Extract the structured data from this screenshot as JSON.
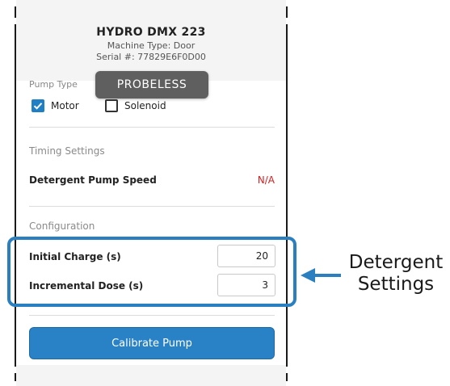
{
  "machine": {
    "name": "HYDRO DMX 223",
    "type_label": "Machine Type: Door",
    "serial_label": "Serial #: 77829E6F0D00"
  },
  "toast": {
    "text": "PROBELESS"
  },
  "section_hint": "Pump Type",
  "pump_type": {
    "options": [
      {
        "label": "Motor",
        "checked": true
      },
      {
        "label": "Solenoid",
        "checked": false
      }
    ]
  },
  "timing": {
    "title": "Timing Settings",
    "rows": [
      {
        "label": "Detergent Pump Speed",
        "value": "N/A"
      }
    ]
  },
  "configuration": {
    "title": "Configuration",
    "fields": [
      {
        "label": "Initial Charge (s)",
        "value": "20"
      },
      {
        "label": "Incremental Dose (s)",
        "value": "3"
      }
    ]
  },
  "calibrate_button": {
    "label": "Calibrate Pump"
  },
  "callout": {
    "line1": "Detergent",
    "line2": "Settings"
  },
  "colors": {
    "accent": "#2a82c6",
    "highlight": "#2a7fc1",
    "error": "#d61f1f",
    "toast": "#5f5f5f"
  },
  "icons": {
    "check": "check-icon",
    "arrow": "arrow-left-icon"
  }
}
